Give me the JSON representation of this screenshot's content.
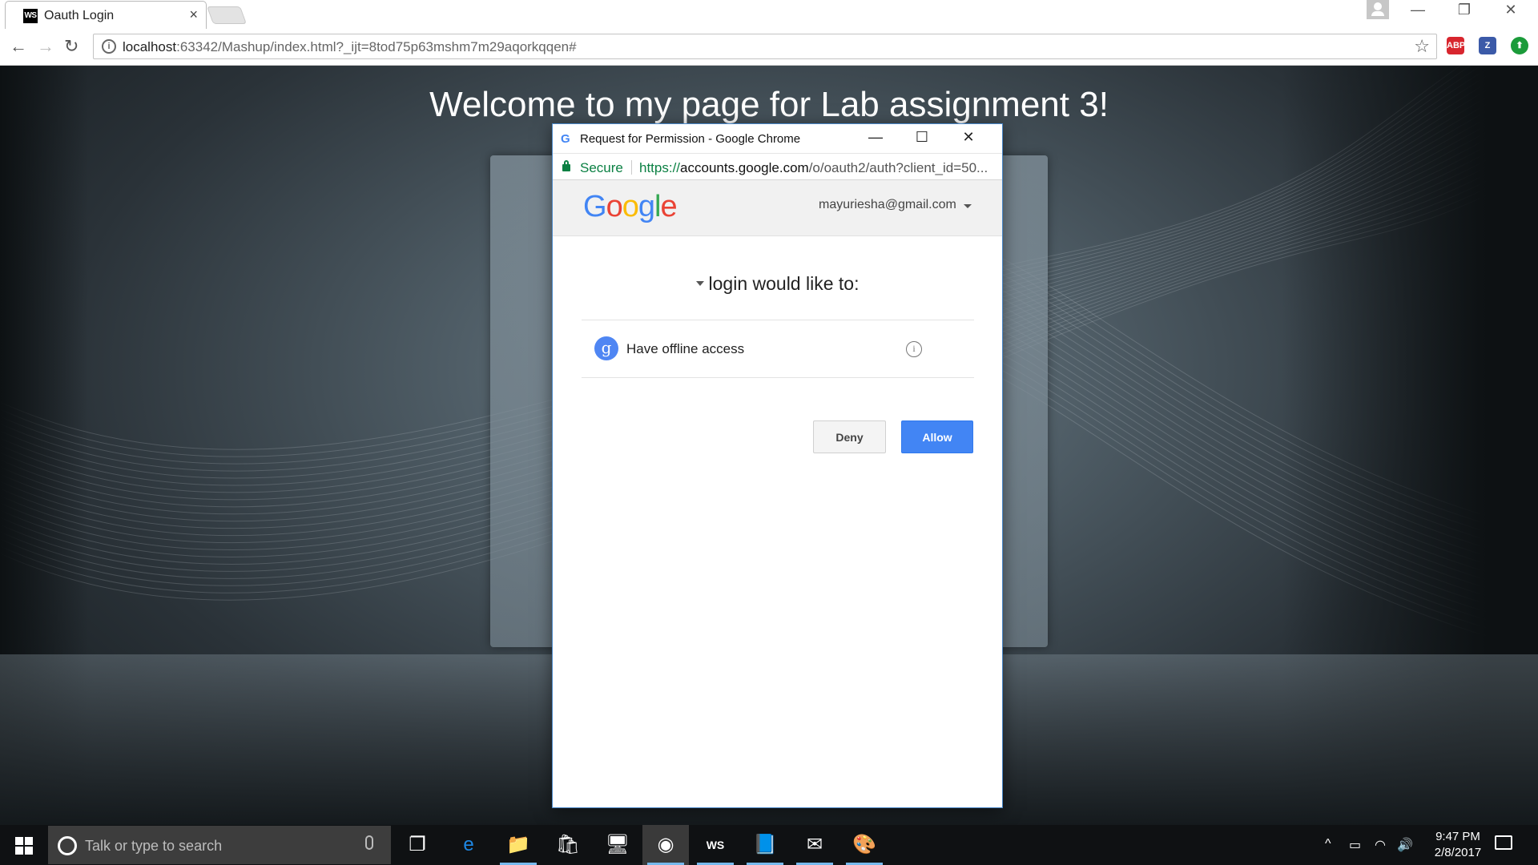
{
  "browser": {
    "tab_title": "Oauth Login",
    "tab_favicon_text": "WS",
    "tab_close": "×",
    "url_host": "localhost",
    "url_rest": ":63342/Mashup/index.html?_ijt=8tod75p63mshm7m29aqorkqqen#",
    "back": "←",
    "forward": "→",
    "reload": "↻",
    "star": "☆",
    "minimize": "—",
    "restore": "❐",
    "close": "✕",
    "extensions": [
      {
        "name": "adblock-plus",
        "text": "ABP",
        "color": "#d8262e"
      },
      {
        "name": "z-extension",
        "text": "Z",
        "color": "#3b5aa8"
      },
      {
        "name": "upload-extension",
        "text": "⬆",
        "color": "#1b9b3a"
      }
    ]
  },
  "page": {
    "heading": "Welcome to my page for Lab assignment 3!"
  },
  "popup": {
    "window_title": "Request for Permission - Google Chrome",
    "icon_letter": "G",
    "minimize": "—",
    "maximize": "☐",
    "close": "✕",
    "secure_label": "Secure",
    "url_scheme": "https://",
    "url_domain": "accounts.google.com",
    "url_path": "/o/oauth2/auth?client_id=50...",
    "google_logo": [
      "G",
      "o",
      "o",
      "g",
      "l",
      "e"
    ],
    "google_logo_colors": [
      "#4285f4",
      "#ea4335",
      "#fbbc05",
      "#4285f4",
      "#34a853",
      "#ea4335"
    ],
    "account_email": "mayuriesha@gmail.com",
    "consent_heading": "login would like to:",
    "scope_icon_letter": "g",
    "scope_label": "Have offline access",
    "scope_info": "i",
    "deny_label": "Deny",
    "allow_label": "Allow"
  },
  "taskbar": {
    "search_placeholder": "Talk or type to search",
    "apps": [
      {
        "name": "task-view",
        "glyph": "❐"
      },
      {
        "name": "edge",
        "glyph": "e",
        "color": "#1e88e5"
      },
      {
        "name": "file-explorer",
        "glyph": "📁"
      },
      {
        "name": "store",
        "glyph": "🛍"
      },
      {
        "name": "remote-desktop",
        "glyph": "🖥"
      },
      {
        "name": "chrome",
        "glyph": "◉",
        "active": true
      },
      {
        "name": "webstorm",
        "glyph": "WS"
      },
      {
        "name": "notepad",
        "glyph": "📘"
      },
      {
        "name": "outlook",
        "glyph": "✉"
      },
      {
        "name": "paint",
        "glyph": "🎨"
      }
    ],
    "tray_up": "^",
    "battery": "▭",
    "wifi": "◠",
    "volume": "🔊",
    "time": "9:47 PM",
    "date": "2/8/2017"
  }
}
